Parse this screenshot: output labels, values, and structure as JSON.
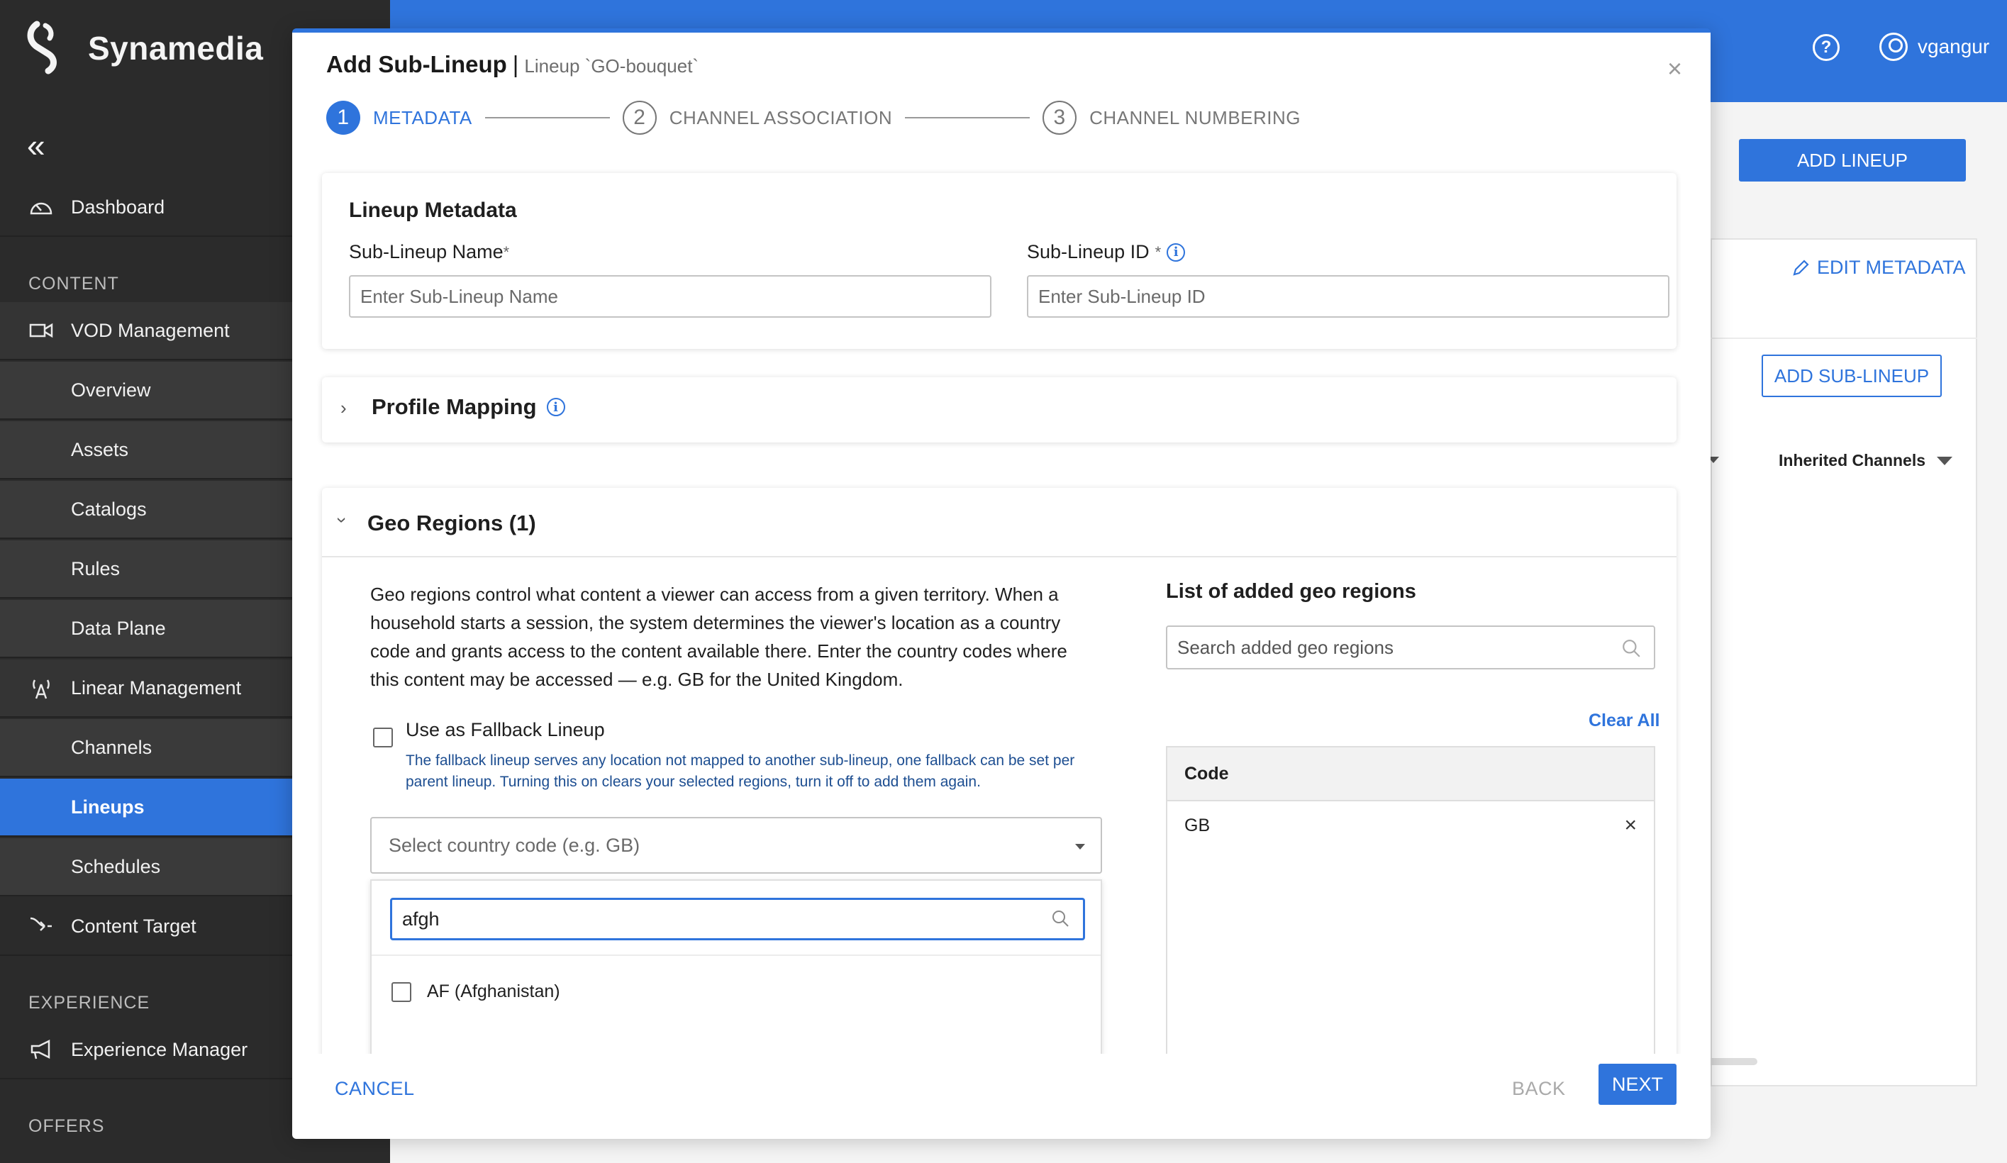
{
  "brand": {
    "name": "Synamedia"
  },
  "sidebar": {
    "collapse_icon": "double-chevron-left-icon",
    "dashboard": "Dashboard",
    "content_section": "CONTENT",
    "vod_management": "VOD Management",
    "vod_items": [
      "Overview",
      "Assets",
      "Catalogs",
      "Rules",
      "Data Plane"
    ],
    "linear_management": "Linear Management",
    "linear_items": [
      "Channels",
      "Lineups",
      "Schedules"
    ],
    "active_item": "Lineups",
    "content_target": "Content Target",
    "experience_section": "EXPERIENCE",
    "experience_manager": "Experience Manager",
    "offers_section": "OFFERS"
  },
  "header": {
    "username": "vgangur"
  },
  "background": {
    "add_lineup": "ADD LINEUP",
    "edit_metadata": "EDIT METADATA",
    "add_sub_lineup": "ADD SUB-LINEUP",
    "inherited_channels": "Inherited Channels"
  },
  "modal": {
    "title": "Add Sub-Lineup",
    "separator": "|",
    "subtitle": "Lineup `GO-bouquet`",
    "steps": [
      {
        "num": "1",
        "label": "METADATA",
        "state": "active"
      },
      {
        "num": "2",
        "label": "CHANNEL ASSOCIATION",
        "state": "pending"
      },
      {
        "num": "3",
        "label": "CHANNEL NUMBERING",
        "state": "pending"
      }
    ],
    "metadata": {
      "heading": "Lineup Metadata",
      "name_label": "Sub-Lineup Name",
      "name_required": "*",
      "name_placeholder": "Enter Sub-Lineup Name",
      "id_label": "Sub-Lineup ID",
      "id_required": "*",
      "id_placeholder": "Enter Sub-Lineup ID"
    },
    "profile_mapping": {
      "heading": "Profile Mapping"
    },
    "geo": {
      "heading": "Geo Regions (1)",
      "description": "Geo regions control what content a viewer can access from a given territory. When a household starts a session, the system determines the viewer's location as a country code and grants access to the content available there. Enter the country codes where this content may be accessed — e.g. GB for the United Kingdom.",
      "fallback_label": "Use as Fallback Lineup",
      "fallback_help": "The fallback lineup serves any location not mapped to another sub-lineup, one fallback can be set per parent lineup. Turning this on clears your selected regions, turn it off to add them again.",
      "fallback_checked": false,
      "select_placeholder": "Select country code (e.g. GB)",
      "dropdown_search_value": "afgh",
      "dropdown_options": [
        {
          "label": "AF (Afghanistan)",
          "checked": false
        }
      ],
      "list_title": "List of added geo regions",
      "list_search_placeholder": "Search added geo regions",
      "clear_all": "Clear All",
      "table_header": "Code",
      "rows": [
        {
          "code": "GB"
        }
      ]
    },
    "footer": {
      "cancel": "CANCEL",
      "back": "BACK",
      "next": "NEXT"
    }
  },
  "colors": {
    "accent": "#2f74dc",
    "sidebar_bg": "#2b2b2b",
    "sidebar_sub_bg": "#3a3a3a"
  }
}
